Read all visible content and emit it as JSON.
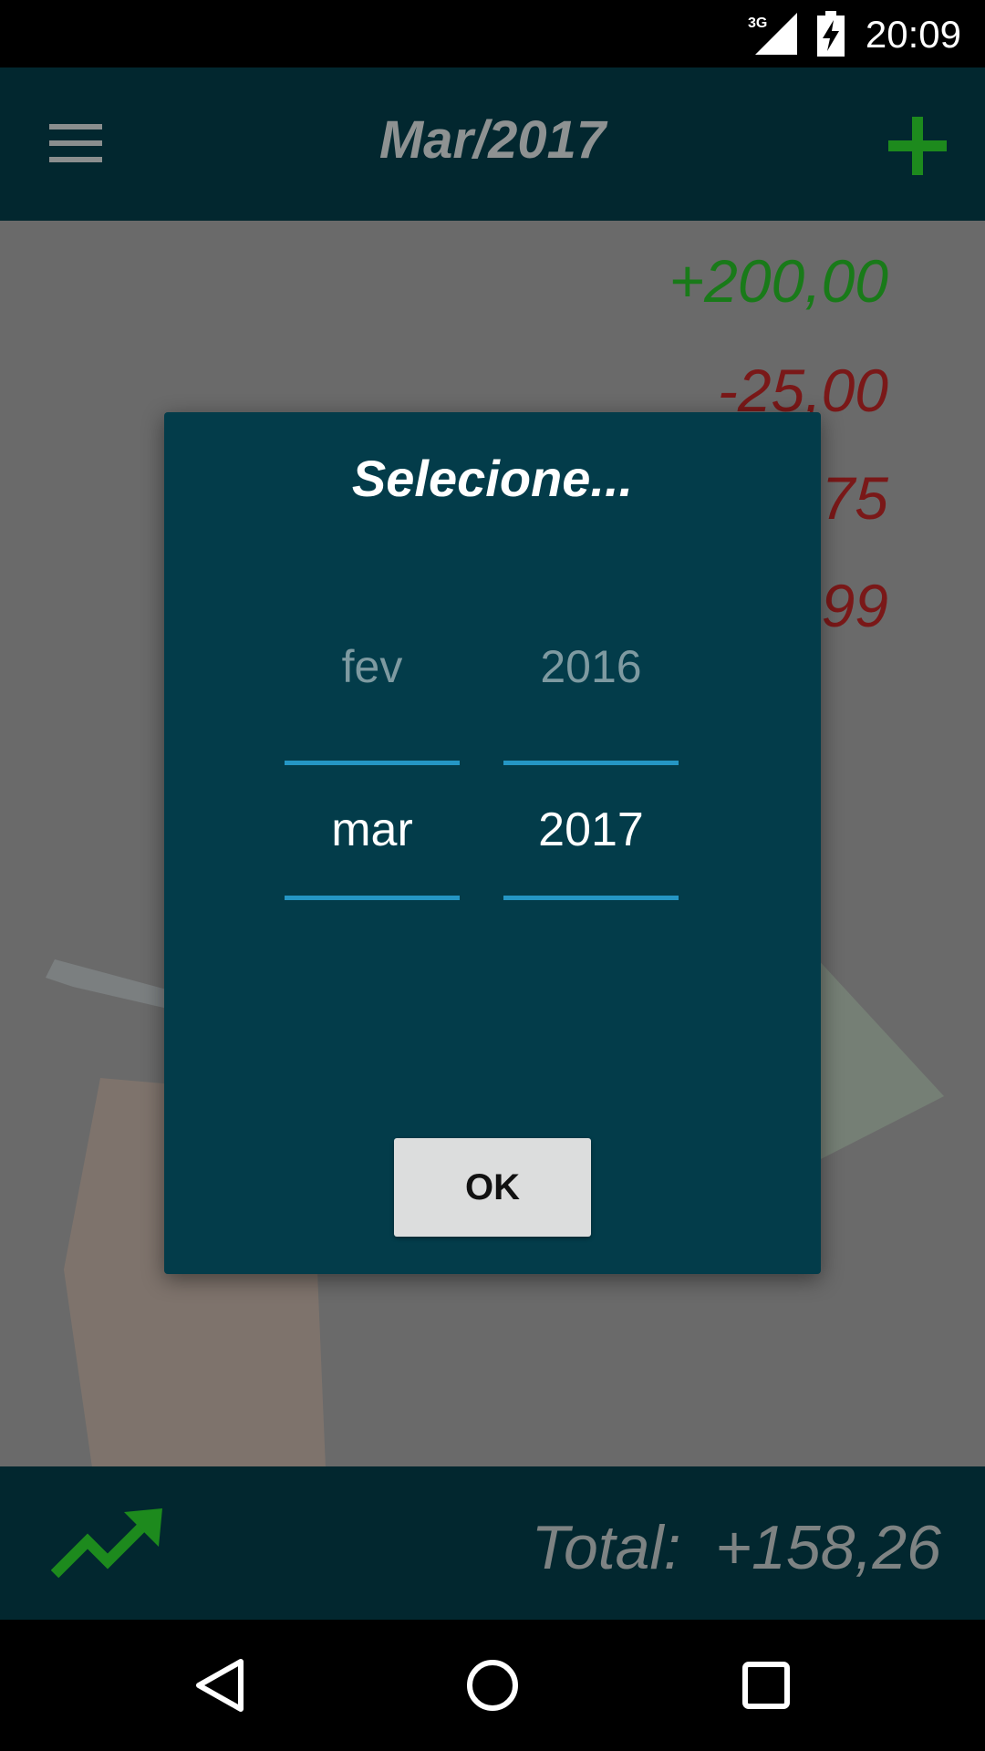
{
  "status_bar": {
    "time": "20:09",
    "network_label": "3G",
    "icons": [
      "signal-icon",
      "battery-charging-icon"
    ]
  },
  "app_bar": {
    "title": "Mar/2017",
    "menu_icon": "menu-icon",
    "add_icon": "add-icon",
    "accent_color": "#1d8a1d"
  },
  "content": {
    "amounts": [
      {
        "text": "+200,00",
        "type": "positive"
      },
      {
        "text": "-25,00",
        "type": "negative"
      },
      {
        "text": "75",
        "type": "negative"
      },
      {
        "text": "99",
        "type": "negative"
      }
    ],
    "positive_color": "#197a19",
    "negative_color": "#7a1818"
  },
  "dialog": {
    "title": "Selecione...",
    "month_picker": {
      "previous": "fev",
      "current": "mar"
    },
    "year_picker": {
      "previous": "2016",
      "current": "2017"
    },
    "ok_label": "OK",
    "background_color": "#033c4a",
    "divider_color": "#2596c4"
  },
  "bottom_bar": {
    "total_label": "Total:",
    "total_value": "+158,26",
    "trend_icon": "trending-up-icon"
  },
  "nav_bar": {
    "buttons": [
      "back-icon",
      "home-icon",
      "recents-icon"
    ]
  }
}
